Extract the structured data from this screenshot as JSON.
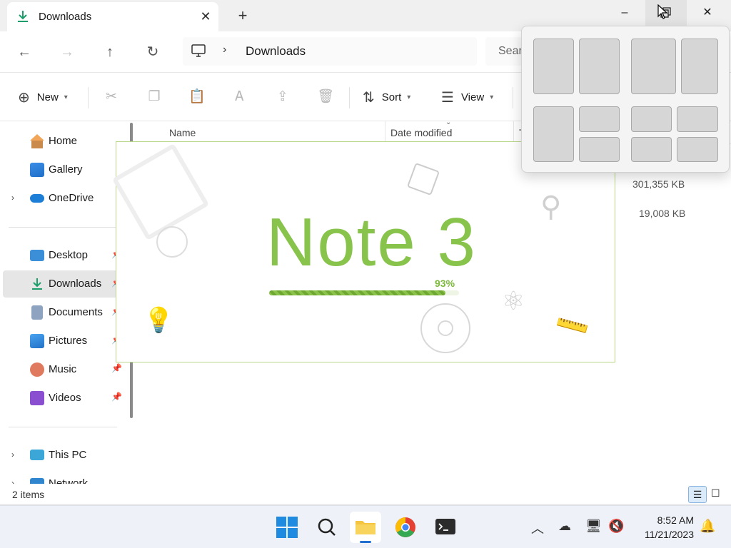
{
  "window": {
    "tab_title": "Downloads",
    "controls": {
      "minimize": "–",
      "maximize": "❐",
      "close": "✕"
    }
  },
  "nav": {
    "breadcrumb": "Downloads",
    "search_placeholder": "Sear"
  },
  "commands": {
    "new_label": "New",
    "sort_label": "Sort",
    "view_label": "View"
  },
  "sidebar": {
    "items": [
      {
        "label": "Home"
      },
      {
        "label": "Gallery"
      },
      {
        "label": "OneDrive"
      },
      {
        "label": "Desktop"
      },
      {
        "label": "Downloads"
      },
      {
        "label": "Documents"
      },
      {
        "label": "Pictures"
      },
      {
        "label": "Music"
      },
      {
        "label": "Videos"
      },
      {
        "label": "This PC"
      },
      {
        "label": "Network"
      }
    ]
  },
  "columns": {
    "name": "Name",
    "date_modified": "Date modified",
    "type_partial": "T"
  },
  "files": [
    {
      "size": "301,355 KB"
    },
    {
      "size": "19,008 KB"
    }
  ],
  "status": {
    "item_count": "2 items"
  },
  "splash": {
    "title": "Note 3",
    "progress_label": "93%",
    "progress": 0.93,
    "accent": "#88c34b"
  },
  "taskbar": {
    "time": "8:52 AM",
    "date": "11/21/2023"
  }
}
